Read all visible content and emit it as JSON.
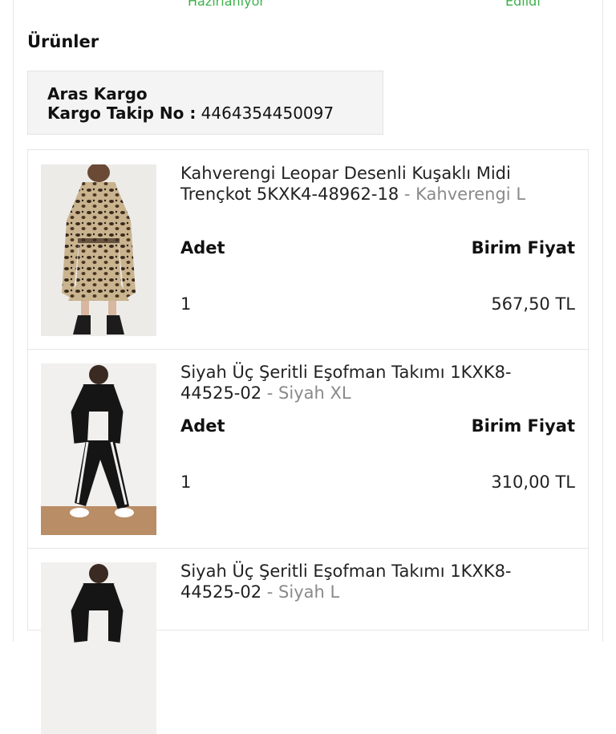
{
  "status": {
    "left": "Hazırlanıyor",
    "right": "Edildi"
  },
  "section_title": "Ürünler",
  "cargo": {
    "company": "Aras Kargo",
    "tracking_label": "Kargo Takip No :",
    "tracking_number": "4464354450097"
  },
  "products": [
    {
      "name": "Kahverengi Leopar Desenli Kuşaklı Midi Trençkot 5KXK4-48962-18",
      "variant": "- Kahverengi L",
      "qty_label": "Adet",
      "price_label": "Birim Fiyat",
      "qty": "1",
      "price": "567,50 TL"
    },
    {
      "name": "Siyah Üç Şeritli Eşofman Takımı 1KXK8-44525-02",
      "variant": "- Siyah XL",
      "qty_label": "Adet",
      "price_label": "Birim Fiyat",
      "qty": "1",
      "price": "310,00 TL"
    },
    {
      "name": "Siyah Üç Şeritli Eşofman Takımı 1KXK8-44525-02",
      "variant": "- Siyah L"
    }
  ]
}
